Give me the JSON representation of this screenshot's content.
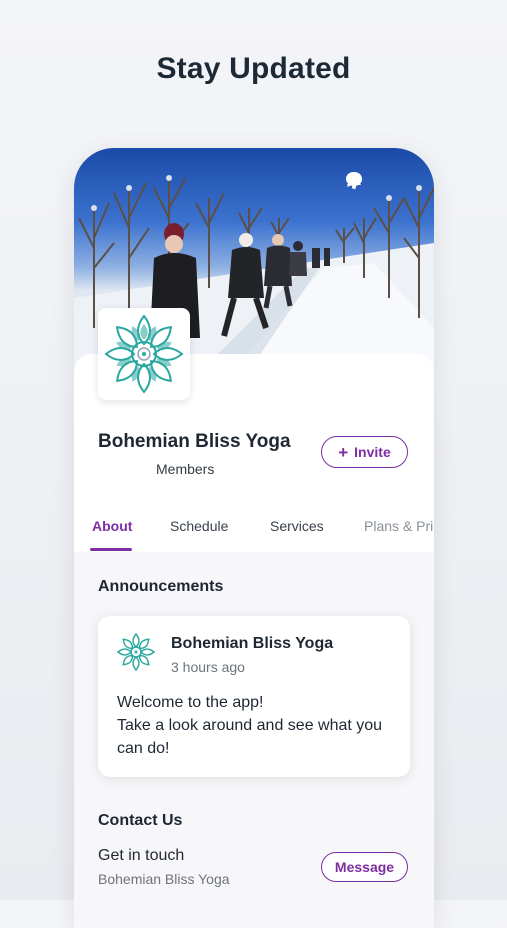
{
  "headline": "Stay Updated",
  "header": {
    "icons": [
      "chat-bubble-icon",
      "bell-icon"
    ]
  },
  "group": {
    "name": "Bohemian Bliss Yoga",
    "members_label": "Members",
    "invite_label": "Invite"
  },
  "tabs": [
    {
      "label": "About",
      "active": true
    },
    {
      "label": "Schedule",
      "active": false
    },
    {
      "label": "Services",
      "active": false
    },
    {
      "label": "Plans & Pricing",
      "active": false
    }
  ],
  "announcements": {
    "title": "Announcements",
    "post": {
      "author": "Bohemian Bliss Yoga",
      "time": "3 hours ago",
      "body_line1": "Welcome to the app!",
      "body_line2": "Take a look around and see what you can do!"
    }
  },
  "contact": {
    "title": "Contact Us",
    "line1": "Get in touch",
    "line2": "Bohemian Bliss Yoga",
    "message_label": "Message"
  },
  "colors": {
    "accent": "#7e2ea3",
    "mandala": "#2aa7a0"
  }
}
